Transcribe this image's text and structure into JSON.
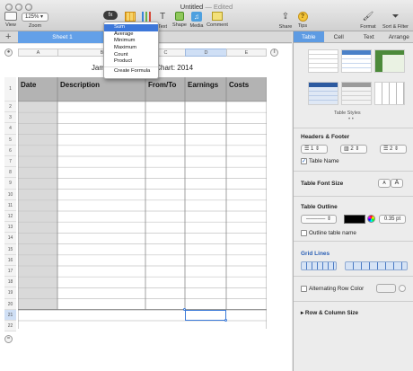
{
  "window": {
    "title": "Untitled",
    "title_suffix": "— Edited"
  },
  "toolbar": {
    "view_label": "View",
    "zoom_value": "125%",
    "zoom_label": "Zoom",
    "fx_label": "fx",
    "left_clip_label": "F",
    "chart_label": "rt",
    "text_label": "Text",
    "shape_label": "Shape",
    "media_label": "Media",
    "comment_label": "Comment",
    "share_label": "Share",
    "tips_label": "Tips",
    "format_label": "Format",
    "sort_label": "Sort & Filter"
  },
  "formula_menu": {
    "items": [
      "Sum",
      "Average",
      "Minimum",
      "Maximum",
      "Count",
      "Product"
    ],
    "selected": "Sum",
    "create": "Create Formula"
  },
  "sheets": {
    "tabs": [
      "Sheet 1"
    ],
    "add_label": "+"
  },
  "table": {
    "title_left": "James",
    "title_right": "il Chart: 2014",
    "columns": [
      "A",
      "B",
      "C",
      "D",
      "E"
    ],
    "headers": [
      "Date",
      "Description",
      "From/To",
      "Earnings",
      "Costs"
    ],
    "rows": [
      "1",
      "2",
      "3",
      "4",
      "5",
      "6",
      "7",
      "8",
      "9",
      "10",
      "11",
      "12",
      "13",
      "14",
      "15",
      "16",
      "17",
      "18",
      "19",
      "20",
      "21",
      "22"
    ]
  },
  "sidebar": {
    "tabs": [
      "Table",
      "Cell",
      "Text",
      "Arrange"
    ],
    "active_tab": "Table",
    "styles_label": "Table Styles",
    "headers_footer_title": "Headers & Footer",
    "header_rows": "1",
    "header_cols": "2",
    "footer_rows": "2",
    "table_name_label": "Table Name",
    "table_name_checked": true,
    "font_size_title": "Table Font Size",
    "font_small": "A",
    "font_large": "A",
    "outline_title": "Table Outline",
    "outline_width": "0.35 pt",
    "outline_name_label": "Outline table name",
    "gridlines_title": "Grid Lines",
    "alt_row_label": "Alternating Row Color",
    "rowcol_size_label": "Row & Column Size"
  },
  "colors": {
    "accent": "#5d9be3",
    "selection": "#3b7ad8",
    "header_fill": "#b3b3b3"
  }
}
